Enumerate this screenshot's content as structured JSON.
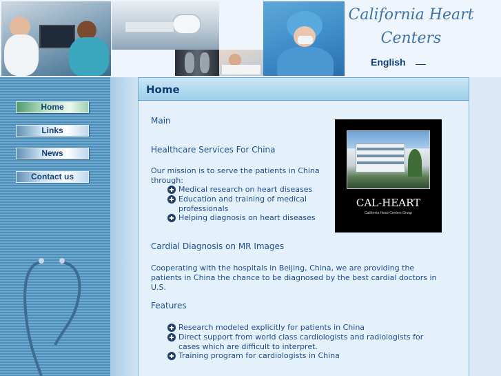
{
  "header": {
    "brand_line1": "California Heart",
    "brand_line2": "Centers",
    "language": "English"
  },
  "nav": [
    {
      "label": "Home",
      "active": true
    },
    {
      "label": "Links",
      "active": false
    },
    {
      "label": "News",
      "active": false
    },
    {
      "label": "Contact us",
      "active": false
    }
  ],
  "panel": {
    "title": "Home",
    "main_label": "Main",
    "section1_heading": "Healthcare Services For China",
    "mission_text": "Our mission is to serve the patients in China through:",
    "mission_items": [
      "Medical research on heart diseases",
      "Education and training of medical professionals",
      "Helping diagnosis on heart diseases"
    ],
    "section2_heading": "Cardial Diagnosis on MR Images",
    "section2_text": "Cooperating with the hospitals in Beijing, China, we are providing the patients in China the chance to be diagnosed by the best cardial doctors in U.S.",
    "section3_heading": "Features",
    "features": [
      "Research modeled explicitly for patients in China",
      "Direct support from world class cardiologists and radiologists for cases which are difficult to interpret.",
      "Training program for cardiologists in China"
    ],
    "logo": {
      "title": "CAL-HEART",
      "subtitle": "California Heart Centers Group"
    }
  },
  "colors": {
    "link_blue": "#1c4c8a",
    "header_title": "#3c73a8",
    "nav_active": "#4f9b6c"
  }
}
